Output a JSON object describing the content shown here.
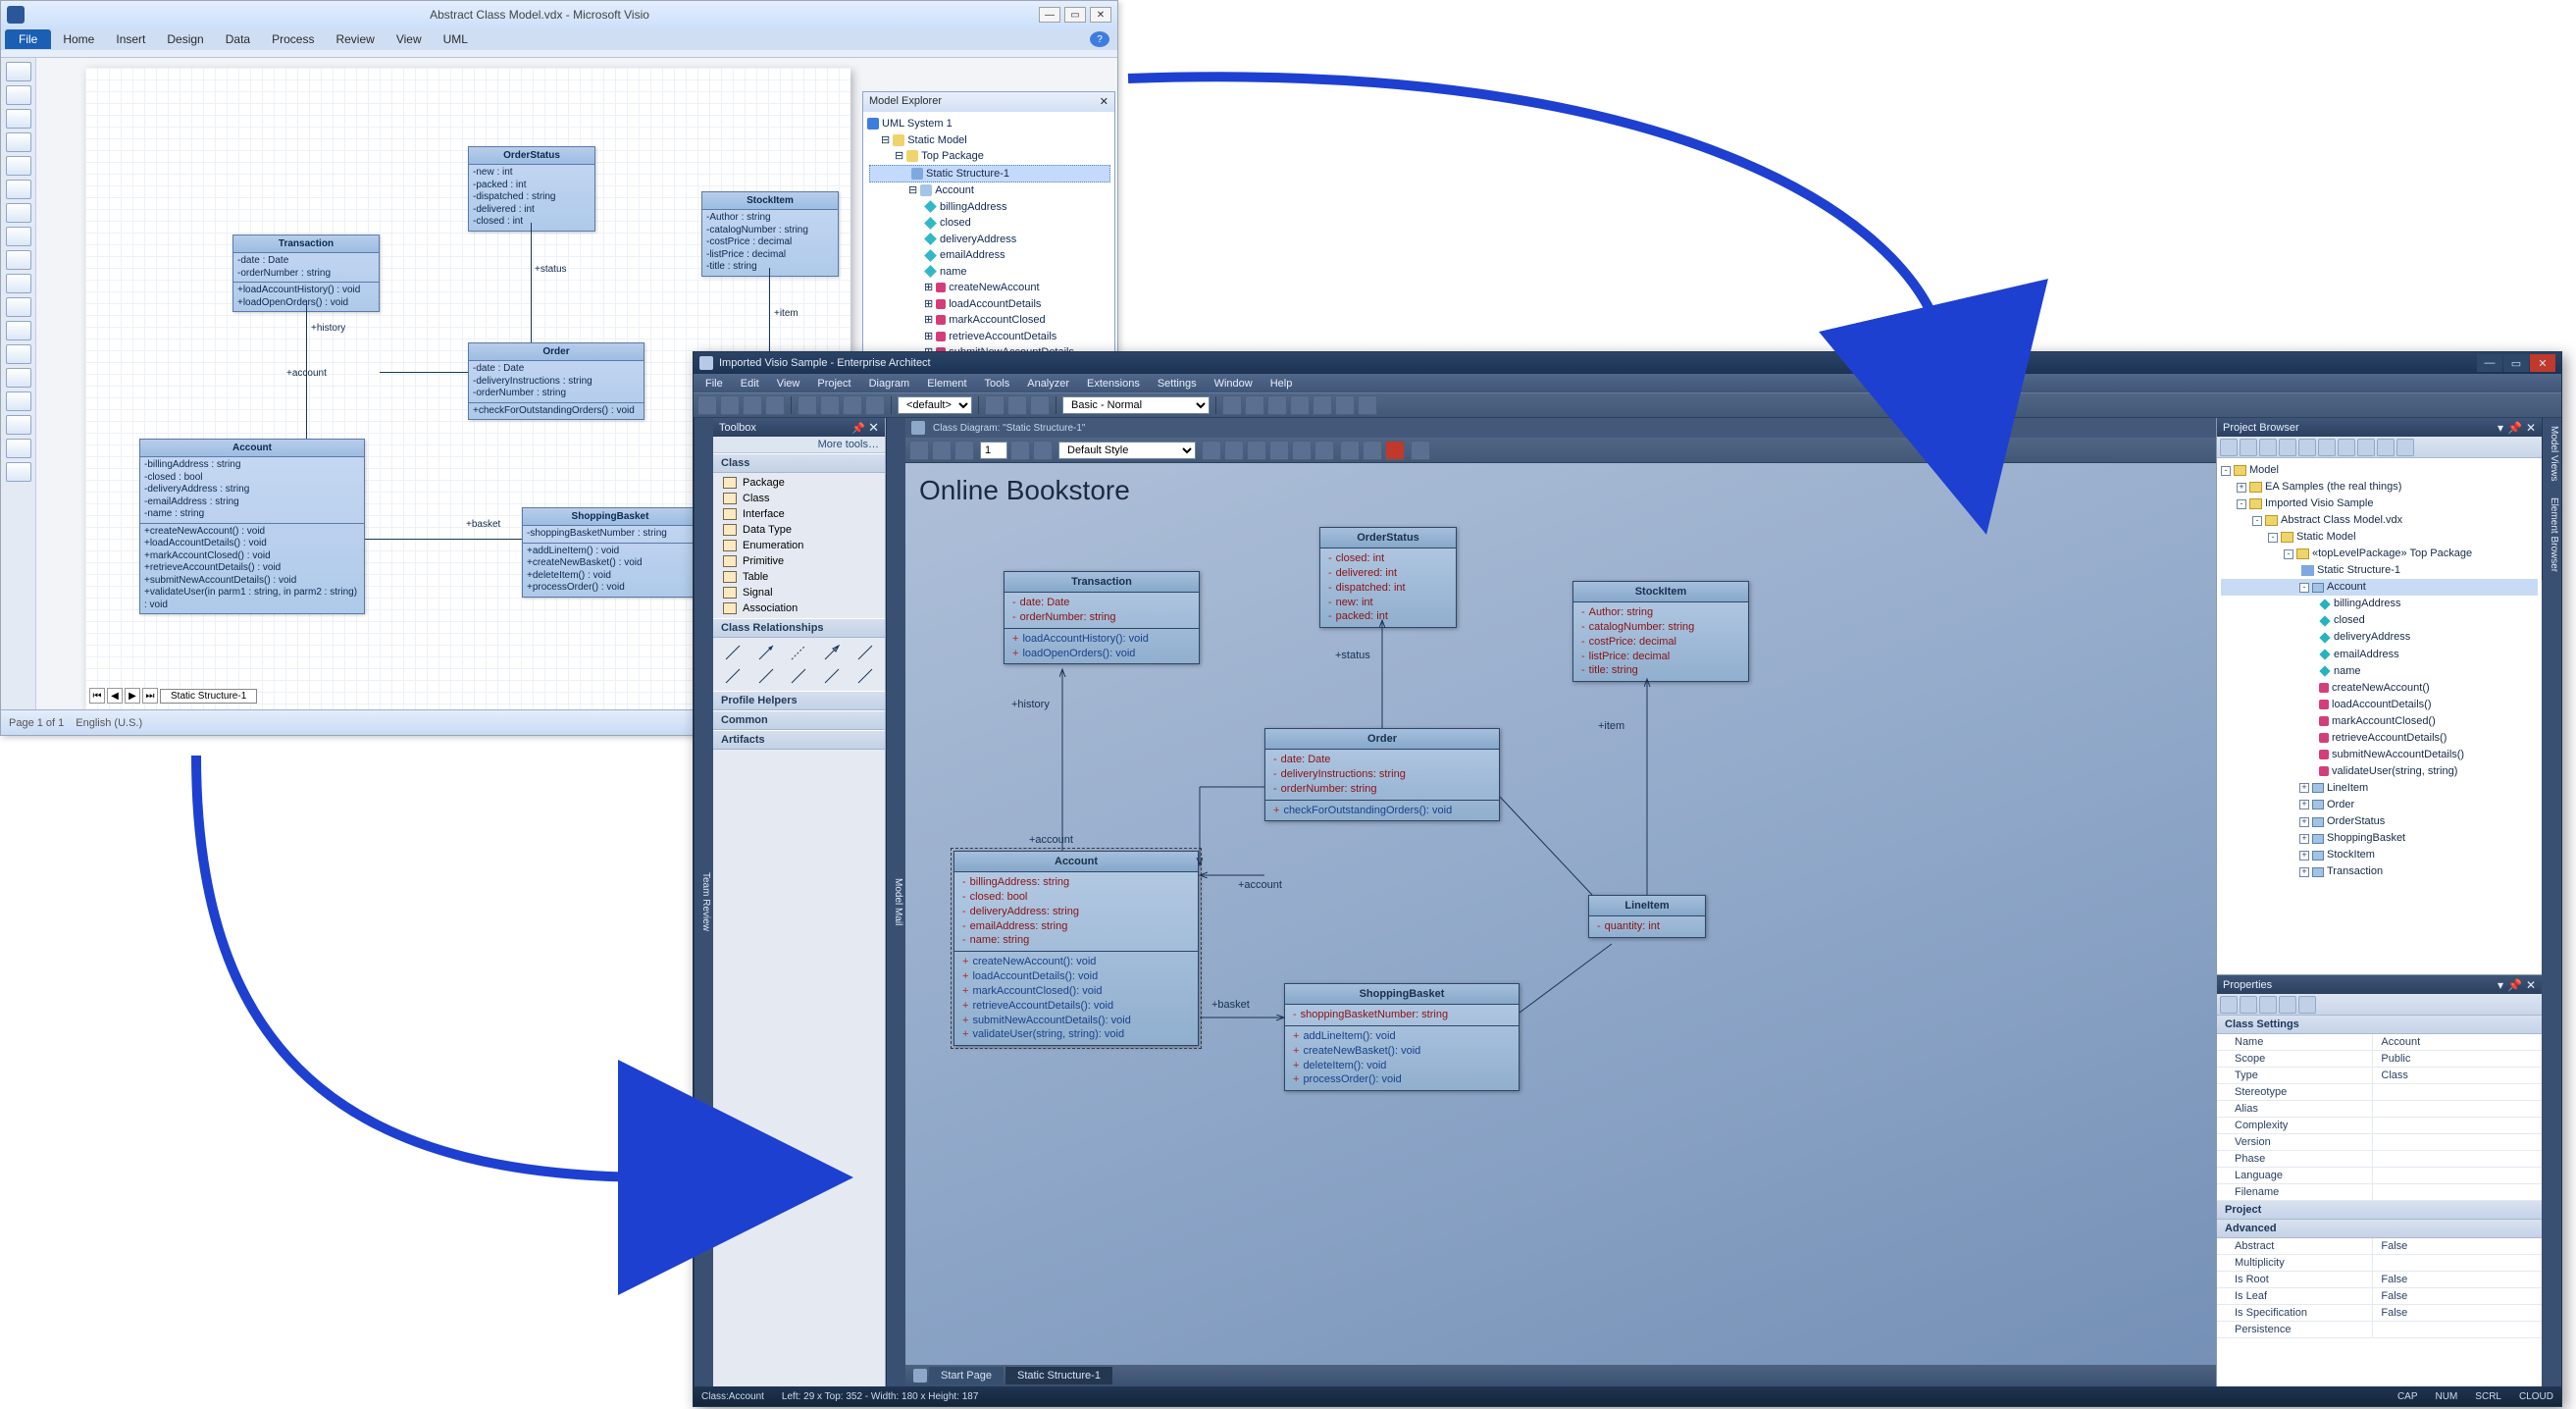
{
  "visio": {
    "title": "Abstract Class Model.vdx - Microsoft Visio",
    "menu": [
      "File",
      "Home",
      "Insert",
      "Design",
      "Data",
      "Process",
      "Review",
      "View",
      "UML"
    ],
    "status": {
      "page": "Page 1 of 1",
      "lang": "English (U.S.)"
    },
    "tab": "Static Structure-1",
    "explorer": {
      "title": "Model Explorer",
      "root": "UML System 1",
      "staticModel": "Static Model",
      "topPackage": "Top Package",
      "selected": "Static Structure-1",
      "account": "Account",
      "attrs": [
        "billingAddress",
        "closed",
        "deliveryAddress",
        "emailAddress",
        "name"
      ],
      "ops": [
        "createNewAccount",
        "loadAccountDetails",
        "markAccountClosed",
        "retrieveAccountDetails",
        "submitNewAccountDetails"
      ]
    },
    "classes": {
      "Transaction": {
        "attrs": [
          "-date : Date",
          "-orderNumber : string"
        ],
        "ops": [
          "+loadAccountHistory() : void",
          "+loadOpenOrders() : void"
        ]
      },
      "OrderStatus": {
        "attrs": [
          "-new : int",
          "-packed : int",
          "-dispatched : string",
          "-delivered : int",
          "-closed : int"
        ]
      },
      "StockItem": {
        "attrs": [
          "-Author : string",
          "-catalogNumber : string",
          "-costPrice : decimal",
          "-listPrice : decimal",
          "-title : string"
        ]
      },
      "Order": {
        "attrs": [
          "-date : Date",
          "-deliveryInstructions : string",
          "-orderNumber : string"
        ],
        "ops": [
          "+checkForOutstandingOrders() : void"
        ]
      },
      "Account": {
        "attrs": [
          "-billingAddress : string",
          "-closed : bool",
          "-deliveryAddress : string",
          "-emailAddress : string",
          "-name : string"
        ],
        "ops": [
          "+createNewAccount() : void",
          "+loadAccountDetails() : void",
          "+markAccountClosed() : void",
          "+retrieveAccountDetails() : void",
          "+submitNewAccountDetails() : void",
          "+validateUser(in parm1 : string, in parm2 : string) : void"
        ]
      },
      "ShoppingBasket": {
        "attrs": [
          "-shoppingBasketNumber : string"
        ],
        "ops": [
          "+addLineItem() : void",
          "+createNewBasket() : void",
          "+deleteItem() : void",
          "+processOrder() : void"
        ]
      }
    },
    "rels": {
      "history": "+history",
      "status": "+status",
      "item": "+item",
      "account": "+account",
      "basket": "+basket"
    }
  },
  "ea": {
    "title": "Imported Visio Sample - Enterprise Architect",
    "menu": [
      "File",
      "Edit",
      "View",
      "Project",
      "Diagram",
      "Element",
      "Tools",
      "Analyzer",
      "Extensions",
      "Settings",
      "Window",
      "Help"
    ],
    "tbDefault": "<default>",
    "tbBasic": "Basic - Normal",
    "tbStyle": "Default Style",
    "tbFontSize": "1",
    "diagTab": "Class Diagram: \"Static Structure-1\"",
    "pageTitle": "Online Bookstore",
    "toolbox": {
      "title": "Toolbox",
      "more": "More tools…",
      "grpClass": "Class",
      "classItems": [
        "Package",
        "Class",
        "Interface",
        "Data Type",
        "Enumeration",
        "Primitive",
        "Table",
        "Signal",
        "Association"
      ],
      "grpRel": "Class Relationships",
      "grpPH": "Profile Helpers",
      "grpCommon": "Common",
      "grpArt": "Artifacts"
    },
    "vtabs": {
      "team": "Team Review",
      "mail": "Model Mail",
      "views": "Model Views",
      "elemBrowser": "Element Browser"
    },
    "classes": {
      "Transaction": {
        "attrs": [
          "date: Date",
          "orderNumber: string"
        ],
        "ops": [
          "loadAccountHistory(): void",
          "loadOpenOrders(): void"
        ]
      },
      "OrderStatus": {
        "attrs": [
          "closed: int",
          "delivered: int",
          "dispatched: int",
          "new: int",
          "packed: int"
        ]
      },
      "StockItem": {
        "attrs": [
          "Author: string",
          "catalogNumber: string",
          "costPrice: decimal",
          "listPrice: decimal",
          "title: string"
        ]
      },
      "Order": {
        "attrs": [
          "date: Date",
          "deliveryInstructions: string",
          "orderNumber: string"
        ],
        "ops": [
          "checkForOutstandingOrders(): void"
        ]
      },
      "Account": {
        "attrs": [
          "billingAddress: string",
          "closed: bool",
          "deliveryAddress: string",
          "emailAddress: string",
          "name: string"
        ],
        "ops": [
          "createNewAccount(): void",
          "loadAccountDetails(): void",
          "markAccountClosed(): void",
          "retrieveAccountDetails(): void",
          "submitNewAccountDetails(): void",
          "validateUser(string, string): void"
        ]
      },
      "LineItem": {
        "attrs": [
          "quantity: int"
        ]
      },
      "ShoppingBasket": {
        "attrs": [
          "shoppingBasketNumber: string"
        ],
        "ops": [
          "addLineItem(): void",
          "createNewBasket(): void",
          "deleteItem(): void",
          "processOrder(): void"
        ]
      }
    },
    "rels": {
      "history": "+history",
      "status": "+status",
      "item": "+item",
      "account": "+account",
      "basket": "+basket"
    },
    "botTabs": {
      "start": "Start Page",
      "ss": "Static Structure-1"
    },
    "status": {
      "class": "Class:Account",
      "pos": "Left:   29 x Top:   352 - Width:   180 x Height:   187",
      "cap": "CAP",
      "num": "NUM",
      "scrl": "SCRL",
      "cloud": "CLOUD"
    },
    "browser": {
      "title": "Project Browser",
      "model": "Model",
      "ea_samples": "EA Samples (the real things)",
      "imported": "Imported Visio Sample",
      "vdx": "Abstract Class Model.vdx",
      "staticModel": "Static Model",
      "topPkg": "«topLevelPackage» Top Package",
      "diagram": "Static Structure-1",
      "account": "Account",
      "accountAttrs": [
        "billingAddress",
        "closed",
        "deliveryAddress",
        "emailAddress",
        "name"
      ],
      "accountOps": [
        "createNewAccount()",
        "loadAccountDetails()",
        "markAccountClosed()",
        "retrieveAccountDetails()",
        "submitNewAccountDetails()",
        "validateUser(string, string)"
      ],
      "others": [
        "LineItem",
        "Order",
        "OrderStatus",
        "ShoppingBasket",
        "StockItem",
        "Transaction"
      ]
    },
    "props": {
      "title": "Properties",
      "settings": [
        [
          "Name",
          "Account"
        ],
        [
          "Scope",
          "Public"
        ],
        [
          "Type",
          "Class"
        ],
        [
          "Stereotype",
          ""
        ],
        [
          "Alias",
          ""
        ],
        [
          "Complexity",
          ""
        ],
        [
          "Version",
          ""
        ],
        [
          "Phase",
          ""
        ],
        [
          "Language",
          ""
        ],
        [
          "Filename",
          ""
        ]
      ],
      "project": "Project",
      "advanced": [
        [
          "Abstract",
          "False"
        ],
        [
          "Multiplicity",
          ""
        ],
        [
          "Is Root",
          "False"
        ],
        [
          "Is Leaf",
          "False"
        ],
        [
          "Is Specification",
          "False"
        ],
        [
          "Persistence",
          ""
        ]
      ]
    }
  }
}
